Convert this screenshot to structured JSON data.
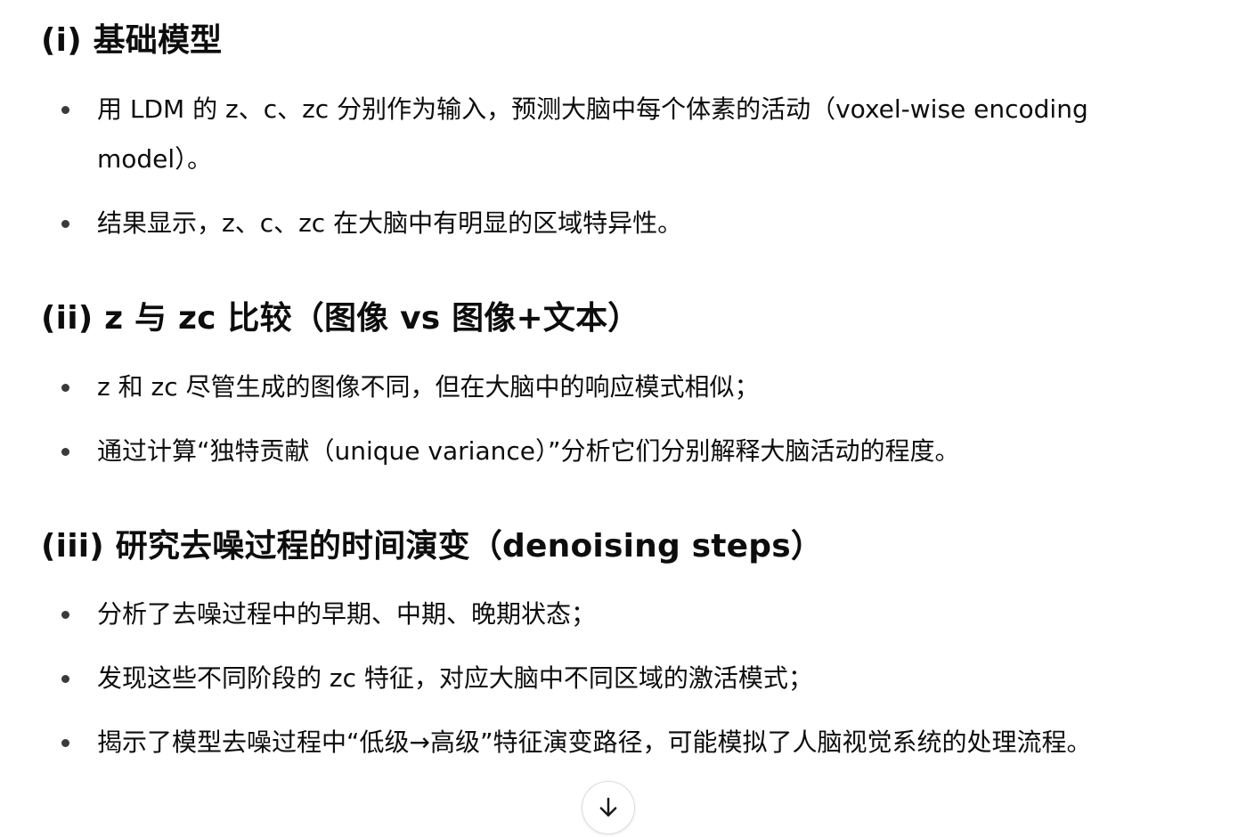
{
  "sections": [
    {
      "heading": "(i) 基础模型",
      "bullets": [
        "用 LDM 的 z、c、zc 分别作为输入，预测大脑中每个体素的活动（voxel-wise encoding model）。",
        "结果显示，z、c、zc 在大脑中有明显的区域特异性。"
      ]
    },
    {
      "heading": "(ii) z 与 zc 比较（图像 vs 图像+文本）",
      "bullets": [
        "z 和 zc 尽管生成的图像不同，但在大脑中的响应模式相似；",
        "通过计算“独特贡献（unique variance）”分析它们分别解释大脑活动的程度。"
      ]
    },
    {
      "heading": "(iii) 研究去噪过程的时间演变（denoising steps）",
      "bullets": [
        "分析了去噪过程中的早期、中期、晚期状态；",
        "发现这些不同阶段的 zc 特征，对应大脑中不同区域的激活模式；",
        "揭示了模型去噪过程中“低级→高级”特征演变路径，可能模拟了人脑视觉系统的处理流程。"
      ]
    }
  ],
  "scroll_button": {
    "icon": "arrow-down-icon"
  }
}
